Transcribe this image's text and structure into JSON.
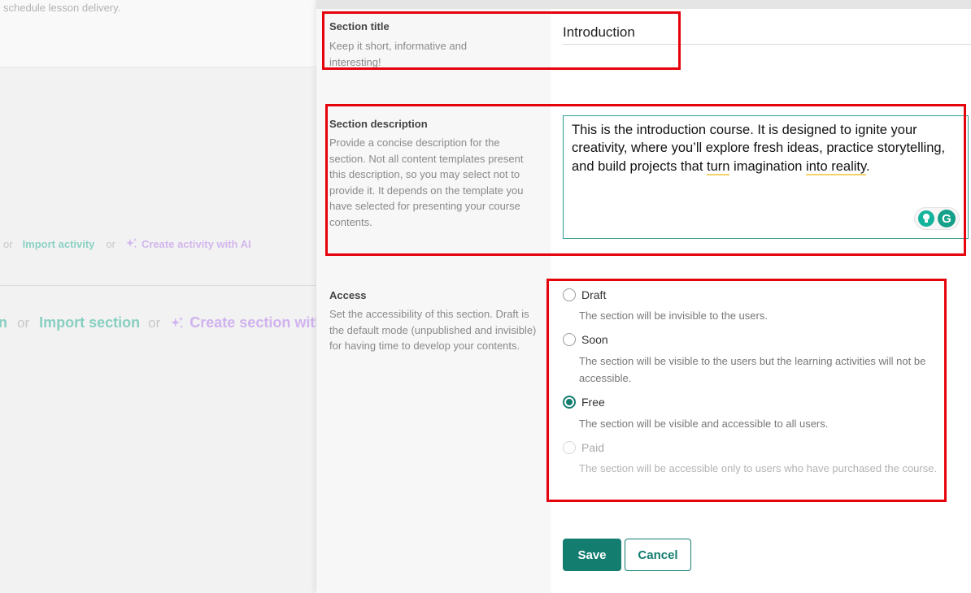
{
  "background": {
    "top_text": "schedule lesson delivery.",
    "activity_row": {
      "or_1": "or",
      "import_label": "Import activity",
      "or_2": "or",
      "ai_label": "Create activity with AI"
    },
    "section_row": {
      "partial_label": "n",
      "or_1": "or",
      "import_label": "Import section",
      "or_2": "or",
      "ai_label": "Create section with"
    }
  },
  "form": {
    "title_field": {
      "label": "Section title",
      "help": "Keep it short, informative and interesting!",
      "value": "Introduction"
    },
    "description_field": {
      "label": "Section description",
      "help": "Provide a concise description for the section. Not all content templates present this description, so you may select not to provide it. It depends on the template you have selected for presenting your course contents.",
      "value_part1": "This is the introduction course. It is designed to ignite your creativity, where you’ll explore fresh ideas, practice storytelling, and build projects that ",
      "value_turn": "turn",
      "value_part2": " imagination ",
      "value_into_reality": "into reality",
      "value_part3": "."
    },
    "access_field": {
      "label": "Access",
      "help": "Set the accessibility of this section. Draft is the default mode (unpublished and invisible) for having time to develop your contents.",
      "selected": "Free",
      "options": [
        {
          "label": "Draft",
          "description": "The section will be invisible to the users."
        },
        {
          "label": "Soon",
          "description": "The section will be visible to the users but the learning activities will not be accessible."
        },
        {
          "label": "Free",
          "description": "The section will be visible and accessible to all users."
        },
        {
          "label": "Paid",
          "description": "The section will be accessible only to users who have purchased the course."
        }
      ]
    },
    "actions": {
      "save_label": "Save",
      "cancel_label": "Cancel"
    }
  },
  "colors": {
    "primary": "#137d70",
    "annotation_red": "#e5020d",
    "teal_faded": "#8cd1c5",
    "purple_faded": "#d2b7ee"
  },
  "icons": {
    "ai": "sparkles-icon",
    "grammarly_suggestion": "lightbulb-icon",
    "grammarly_logo": "grammarly-logo-icon"
  }
}
